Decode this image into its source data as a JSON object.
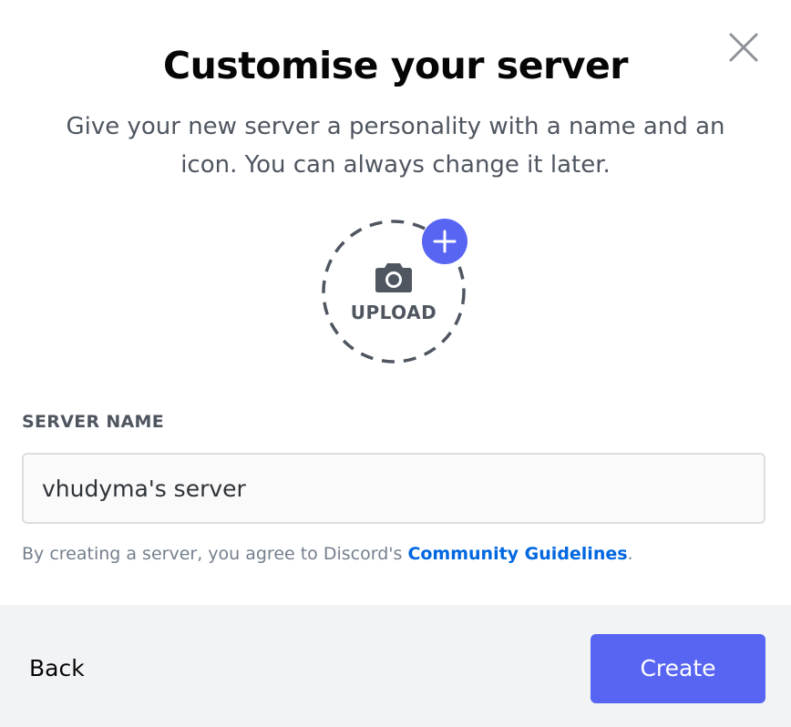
{
  "dialog": {
    "title": "Customise your server",
    "subtitle": "Give your new server a personality with a name and an icon. You can always change it later."
  },
  "upload": {
    "label": "UPLOAD",
    "icon": "camera-icon",
    "badge_icon": "plus-icon"
  },
  "form": {
    "field_label": "SERVER NAME",
    "server_name_value": "vhudyma's server"
  },
  "terms": {
    "prefix": "By creating a server, you agree to Discord's ",
    "link_text": "Community Guidelines",
    "suffix": "."
  },
  "footer": {
    "back_label": "Back",
    "create_label": "Create"
  },
  "colors": {
    "brand": "#5865f2",
    "link": "#0067e0",
    "footer_bg": "#f2f3f5",
    "muted_text": "#4f5660"
  }
}
